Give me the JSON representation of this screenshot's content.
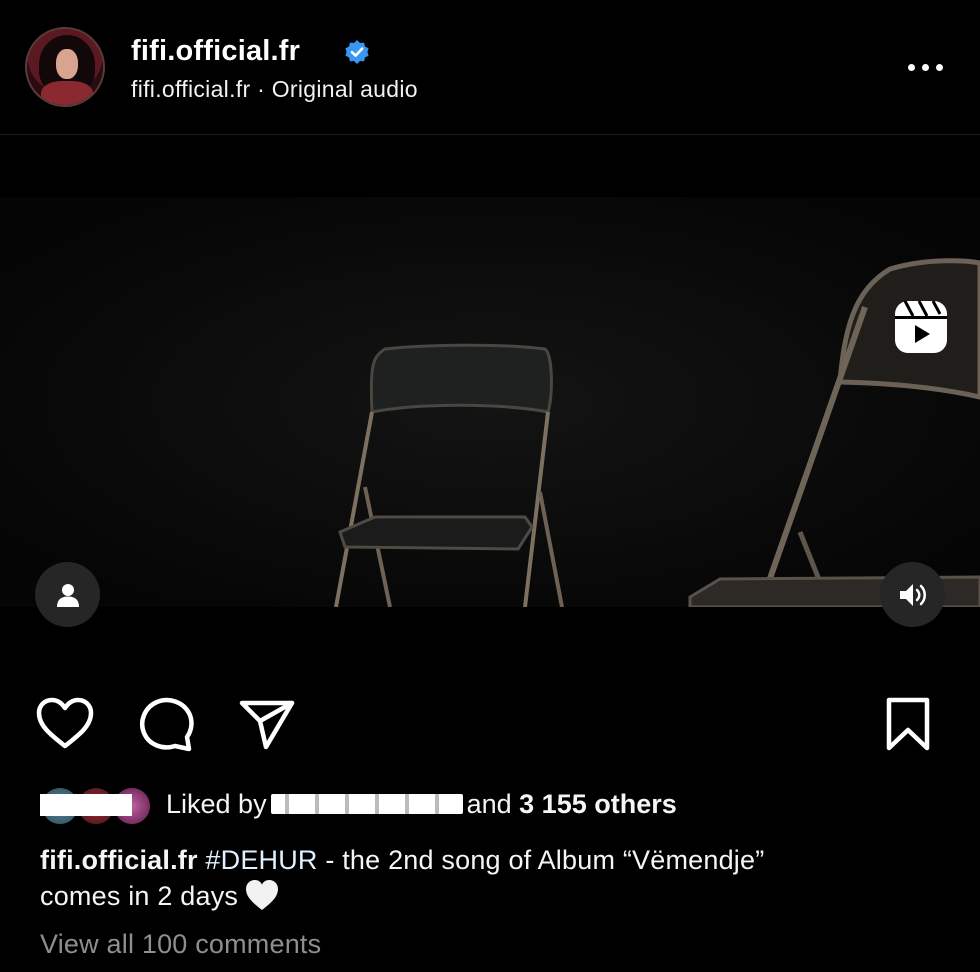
{
  "post": {
    "header": {
      "username": "fifi.official.fr",
      "subline": "fifi.official.fr · Original audio",
      "verified": true,
      "more_icon": "more-horizontal-icon"
    },
    "media": {
      "reels_icon": "reels-icon",
      "tag_icon": "user-tag-icon",
      "audio_icon": "speaker-on-icon"
    },
    "actions": {
      "like_icon": "heart-outline-icon",
      "comment_icon": "comment-bubble-icon",
      "share_icon": "paper-plane-icon",
      "save_icon": "bookmark-outline-icon"
    },
    "likes": {
      "prefix": "Liked by",
      "suffix_connector": "and",
      "others": "3 155 others"
    },
    "caption": {
      "username": "fifi.official.fr",
      "hashtag": "#DEHUR",
      "text_line1": " - the 2nd song of Album “Vëmendje”",
      "text_line2": "comes in 2 days",
      "emoji": "white-heart-icon"
    },
    "view_comments": "View all 100 comments"
  },
  "colors": {
    "background": "#000000",
    "verified_blue": "#3897f0",
    "muted_text": "#8e8e8e",
    "hashtag": "#e0f1ff",
    "overlay_button": "#262626"
  }
}
